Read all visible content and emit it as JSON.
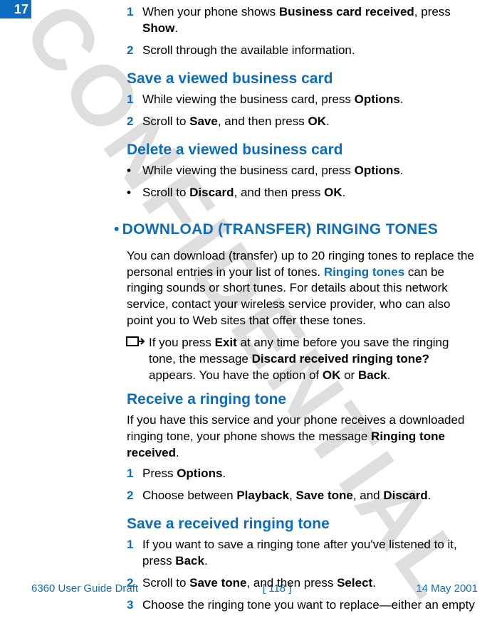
{
  "chapter": "17",
  "watermark": "CONFIDENTIAL",
  "section1": {
    "steps": [
      {
        "n": "1",
        "p1": "When your phone shows ",
        "b1": "Business card received",
        "p2": ", press ",
        "b2": "Show",
        "p3": "."
      },
      {
        "n": "2",
        "p1": "Scroll through the available information."
      }
    ]
  },
  "save_viewed": {
    "heading": "Save a viewed business card",
    "steps": [
      {
        "n": "1",
        "p1": "While viewing the business card, press ",
        "b1": "Options",
        "p2": "."
      },
      {
        "n": "2",
        "p1": "Scroll to ",
        "b1": "Save",
        "p2": ", and then press ",
        "b2": "OK",
        "p3": "."
      }
    ]
  },
  "delete_viewed": {
    "heading": "Delete a viewed business card",
    "bullets": [
      {
        "p1": "While viewing the business card, press ",
        "b1": "Options",
        "p2": "."
      },
      {
        "p1": "Scroll to ",
        "b1": "Discard",
        "p2": ", and then press ",
        "b2": "OK",
        "p3": "."
      }
    ]
  },
  "download": {
    "bullet": "•",
    "heading": "DOWNLOAD (TRANSFER) RINGING TONES",
    "para_a": "You can download (transfer) up to 20 ringing tones to replace the personal entries in your list of tones. ",
    "link": "Ringing tones",
    "para_b": " can be ringing sounds or short tunes. For details about this network service, contact your wireless service provider, who can also point you to Web sites that offer these tones.",
    "note": {
      "p1": "If you press ",
      "b1": "Exit",
      "p2": " at any time before you save the ringing tone, the message ",
      "b2": "Discard received ringing tone?",
      "p3": " appears. You have the option of ",
      "b3": "OK",
      "p4": " or ",
      "b4": "Back",
      "p5": "."
    }
  },
  "receive": {
    "heading": "Receive a ringing tone",
    "intro_a": "If you have this service and your phone receives a downloaded ringing tone, your phone shows the message ",
    "intro_b": "Ringing tone received",
    "intro_c": ".",
    "steps": [
      {
        "n": "1",
        "p1": "Press ",
        "b1": "Options",
        "p2": "."
      },
      {
        "n": "2",
        "p1": "Choose between ",
        "b1": "Playback",
        "p2": ", ",
        "b2": "Save tone",
        "p3": ", and ",
        "b3": "Discard",
        "p4": "."
      }
    ]
  },
  "save_ring": {
    "heading": "Save a received ringing tone",
    "steps": [
      {
        "n": "1",
        "p1": "If you want to save a ringing tone after you've listened to it, press ",
        "b1": "Back",
        "p2": "."
      },
      {
        "n": "2",
        "p1": "Scroll to ",
        "b1": "Save tone",
        "p2": ", and then press ",
        "b2": "Select",
        "p3": "."
      },
      {
        "n": "3",
        "p1": "Choose the ringing tone you want to replace—either an empty"
      }
    ]
  },
  "footer": {
    "left": "6360 User Guide Draft",
    "center": "[ 118 ]",
    "right": "14 May 2001"
  }
}
